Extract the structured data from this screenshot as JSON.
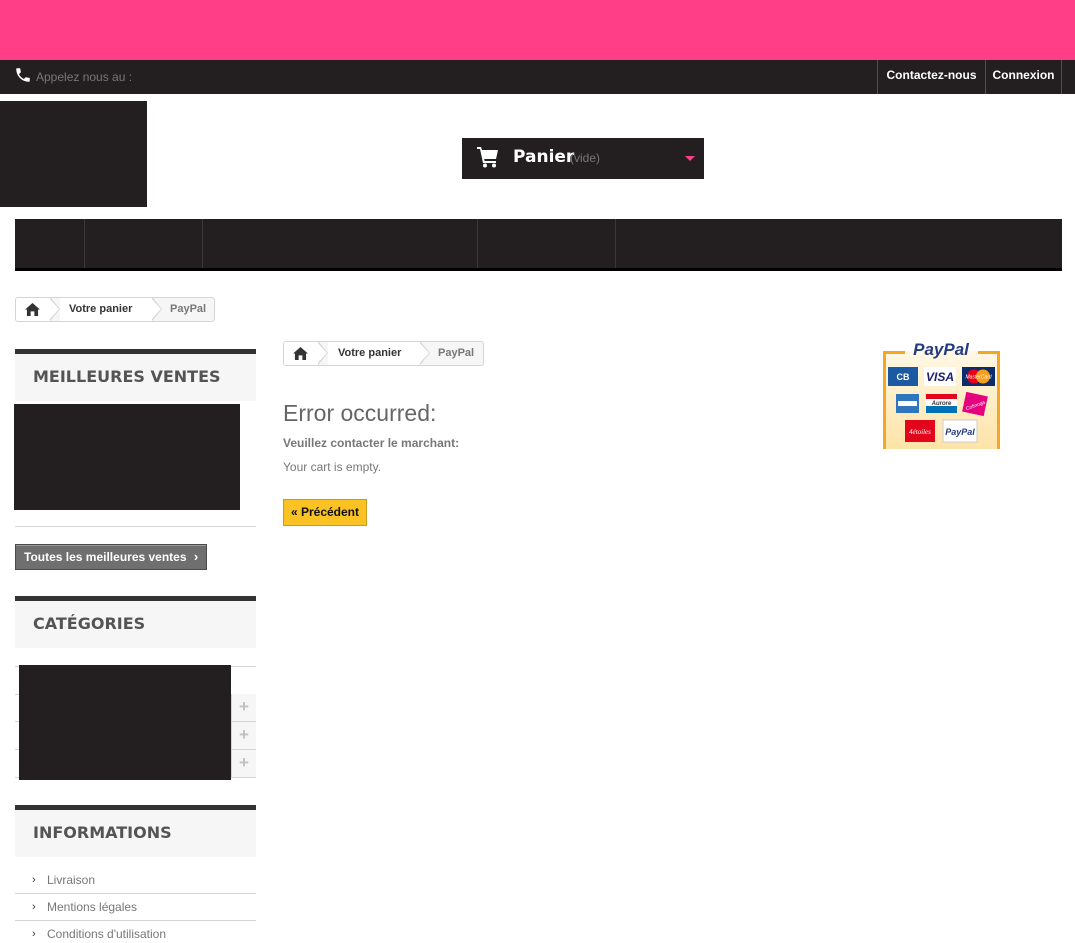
{
  "topbar": {
    "phone_label": "Appelez nous au :",
    "contact_label": "Contactez-nous",
    "login_label": "Connexion"
  },
  "cart": {
    "title": "Panier",
    "status": "(vide)"
  },
  "breadcrumb_top": {
    "step": "Votre panier",
    "current": "PayPal"
  },
  "breadcrumb_main": {
    "step": "Votre panier",
    "current": "PayPal"
  },
  "sidebar": {
    "bestsellers_title": "Meilleures ventes",
    "bestsellers_button": "Toutes les meilleures ventes",
    "categories_title": "Catégories",
    "info_title": "Informations",
    "info_links": [
      "Livraison",
      "Mentions légales",
      "Conditions d'utilisation"
    ]
  },
  "main": {
    "title": "Error occurred:",
    "contact_label": "Veuillez contacter le marchant:",
    "error_message": "Your cart is empty.",
    "back_button": "« Précédent"
  },
  "paypal": {
    "brand": "PayPal",
    "cards": [
      "CB",
      "VISA",
      "MasterCard",
      "American Express",
      "Aurore",
      "Cofinoga",
      "4étoiles",
      "PayPal"
    ]
  },
  "colors": {
    "accent": "#ff3e87",
    "dark": "#231f20",
    "button_yellow": "#fbc224"
  }
}
